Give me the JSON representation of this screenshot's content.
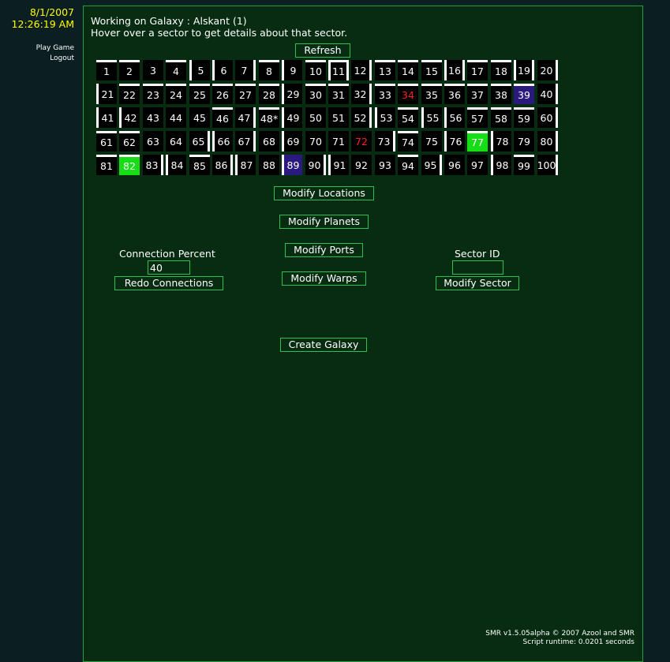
{
  "sidebar": {
    "date": "8/1/2007",
    "time": "12:26:19 AM",
    "links": [
      "Play Game",
      "Logout"
    ]
  },
  "heading": {
    "line1": "Working on Galaxy : Alskant (1)",
    "line2": "Hover over a sector to get details about that sector."
  },
  "buttons": {
    "refresh": "Refresh",
    "modify_locations": "Modify Locations",
    "modify_planets": "Modify Planets",
    "modify_ports": "Modify Ports",
    "modify_warps": "Modify Warps",
    "redo_connections": "Redo Connections",
    "modify_sector": "Modify Sector",
    "create_galaxy": "Create Galaxy"
  },
  "connection": {
    "label": "Connection Percent",
    "value": "40"
  },
  "sector_id": {
    "label": "Sector ID",
    "value": ""
  },
  "grid": {
    "columns": 20,
    "rows": 5,
    "sectors": [
      {
        "n": "1",
        "w": "t"
      },
      {
        "n": "2",
        "w": "t"
      },
      {
        "n": "3",
        "w": ""
      },
      {
        "n": "4",
        "w": "t"
      },
      {
        "n": "5",
        "w": "l"
      },
      {
        "n": "6",
        "w": "l"
      },
      {
        "n": "7",
        "w": "r"
      },
      {
        "n": "8",
        "w": "t"
      },
      {
        "n": "9",
        "w": "l"
      },
      {
        "n": "10",
        "w": "t"
      },
      {
        "n": "11",
        "w": "tlr"
      },
      {
        "n": "12",
        "w": "r"
      },
      {
        "n": "13",
        "w": "t"
      },
      {
        "n": "14",
        "w": "t"
      },
      {
        "n": "15",
        "w": "t"
      },
      {
        "n": "16",
        "w": "lr"
      },
      {
        "n": "17",
        "w": "t"
      },
      {
        "n": "18",
        "w": "t"
      },
      {
        "n": "19",
        "w": "lr"
      },
      {
        "n": "20",
        "w": "r"
      },
      {
        "n": "21",
        "w": "l"
      },
      {
        "n": "22",
        "w": "t"
      },
      {
        "n": "23",
        "w": "t"
      },
      {
        "n": "24",
        "w": "t"
      },
      {
        "n": "25",
        "w": "t"
      },
      {
        "n": "26",
        "w": "t"
      },
      {
        "n": "27",
        "w": "t"
      },
      {
        "n": "28",
        "w": "t"
      },
      {
        "n": "29",
        "w": "l"
      },
      {
        "n": "30",
        "w": "t"
      },
      {
        "n": "31",
        "w": "t"
      },
      {
        "n": "32",
        "w": "r"
      },
      {
        "n": "33",
        "w": "t"
      },
      {
        "n": "34",
        "w": "t",
        "red": true
      },
      {
        "n": "35",
        "w": "t"
      },
      {
        "n": "36",
        "w": "t"
      },
      {
        "n": "37",
        "w": "t"
      },
      {
        "n": "38",
        "w": "t"
      },
      {
        "n": "39",
        "w": "t",
        "hl": "purple"
      },
      {
        "n": "40",
        "w": "r"
      },
      {
        "n": "41",
        "w": "l"
      },
      {
        "n": "42",
        "w": "l"
      },
      {
        "n": "43",
        "w": ""
      },
      {
        "n": "44",
        "w": ""
      },
      {
        "n": "45",
        "w": ""
      },
      {
        "n": "46",
        "w": "t"
      },
      {
        "n": "47",
        "w": "r"
      },
      {
        "n": "48*",
        "w": "t"
      },
      {
        "n": "49",
        "w": "l"
      },
      {
        "n": "50",
        "w": ""
      },
      {
        "n": "51",
        "w": ""
      },
      {
        "n": "52",
        "w": "r"
      },
      {
        "n": "53",
        "w": "l"
      },
      {
        "n": "54",
        "w": "t"
      },
      {
        "n": "55",
        "w": "l"
      },
      {
        "n": "56",
        "w": "l"
      },
      {
        "n": "57",
        "w": "t"
      },
      {
        "n": "58",
        "w": "t"
      },
      {
        "n": "59",
        "w": "t"
      },
      {
        "n": "60",
        "w": "r"
      },
      {
        "n": "61",
        "w": "t"
      },
      {
        "n": "62",
        "w": "t"
      },
      {
        "n": "63",
        "w": ""
      },
      {
        "n": "64",
        "w": ""
      },
      {
        "n": "65",
        "w": "r"
      },
      {
        "n": "66",
        "w": "l"
      },
      {
        "n": "67",
        "w": "r"
      },
      {
        "n": "68",
        "w": ""
      },
      {
        "n": "69",
        "w": "l"
      },
      {
        "n": "70",
        "w": ""
      },
      {
        "n": "71",
        "w": ""
      },
      {
        "n": "72",
        "w": "",
        "red": true
      },
      {
        "n": "73",
        "w": "r"
      },
      {
        "n": "74",
        "w": "t"
      },
      {
        "n": "75",
        "w": ""
      },
      {
        "n": "76",
        "w": "l"
      },
      {
        "n": "77",
        "w": "t",
        "hl": "green"
      },
      {
        "n": "78",
        "w": "l"
      },
      {
        "n": "79",
        "w": ""
      },
      {
        "n": "80",
        "w": "r"
      },
      {
        "n": "81",
        "w": "t"
      },
      {
        "n": "82",
        "w": "t",
        "hl": "green"
      },
      {
        "n": "83",
        "w": "r"
      },
      {
        "n": "84",
        "w": "l"
      },
      {
        "n": "85",
        "w": "t"
      },
      {
        "n": "86",
        "w": "r"
      },
      {
        "n": "87",
        "w": "l"
      },
      {
        "n": "88",
        "w": ""
      },
      {
        "n": "89",
        "w": "l",
        "hl": "purple"
      },
      {
        "n": "90",
        "w": "r"
      },
      {
        "n": "91",
        "w": "l"
      },
      {
        "n": "92",
        "w": ""
      },
      {
        "n": "93",
        "w": ""
      },
      {
        "n": "94",
        "w": "t"
      },
      {
        "n": "95",
        "w": "r"
      },
      {
        "n": "96",
        "w": ""
      },
      {
        "n": "97",
        "w": ""
      },
      {
        "n": "98",
        "w": "l"
      },
      {
        "n": "99",
        "w": "t"
      },
      {
        "n": "100",
        "w": "r"
      }
    ]
  },
  "colors": {
    "page_bg": "#0b1f22",
    "panel_bg": "#072c12",
    "accent_border": "#2dbf55",
    "date_text": "#ffff00",
    "red_sector": "#ff2020",
    "green_highlight": "#16dd16",
    "purple_highlight": "#2a1a80"
  },
  "footer": {
    "version": "SMR v1.5.05alpha © 2007 Azool and SMR",
    "runtime": "Script runtime: 0.0201 seconds"
  }
}
